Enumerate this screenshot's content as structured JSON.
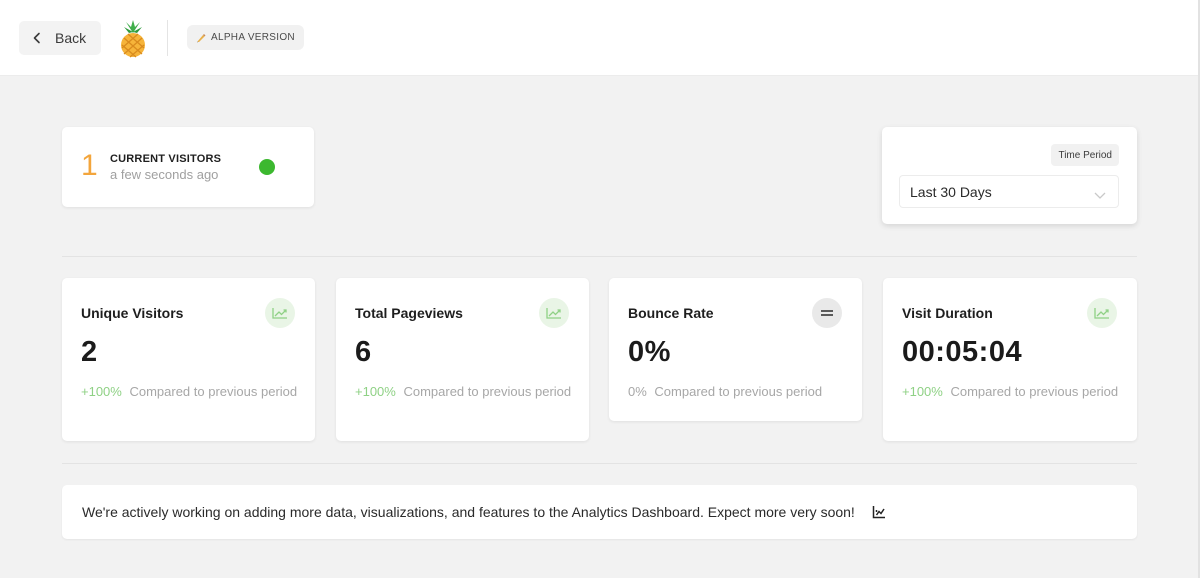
{
  "header": {
    "back_label": "Back",
    "badge_label": "ALPHA VERSION"
  },
  "current_visitors": {
    "count": "1",
    "title": "CURRENT VISITORS",
    "updated": "a few seconds ago",
    "status_color": "#3cb82f"
  },
  "time_period": {
    "label": "Time Period",
    "selected": "Last 30 Days"
  },
  "stats": [
    {
      "title": "Unique Visitors",
      "value": "2",
      "delta": "+100%",
      "compare": "Compared to previous period",
      "trend": "up",
      "icon": "trend-up-icon"
    },
    {
      "title": "Total Pageviews",
      "value": "6",
      "delta": "+100%",
      "compare": "Compared to previous period",
      "trend": "up",
      "icon": "trend-up-icon"
    },
    {
      "title": "Bounce Rate",
      "value": "0%",
      "delta": "0%",
      "compare": "Compared to previous period",
      "trend": "flat",
      "icon": "equals-icon"
    },
    {
      "title": "Visit Duration",
      "value": "00:05:04",
      "delta": "+100%",
      "compare": "Compared to previous period",
      "trend": "up",
      "icon": "trend-up-icon"
    }
  ],
  "notice": {
    "text": "We're actively working on adding more data, visualizations, and features to the Analytics Dashboard. Expect more very soon!"
  },
  "colors": {
    "accent_orange": "#f3a53c",
    "positive_green": "#8fd185",
    "live_green": "#3cb82f"
  }
}
